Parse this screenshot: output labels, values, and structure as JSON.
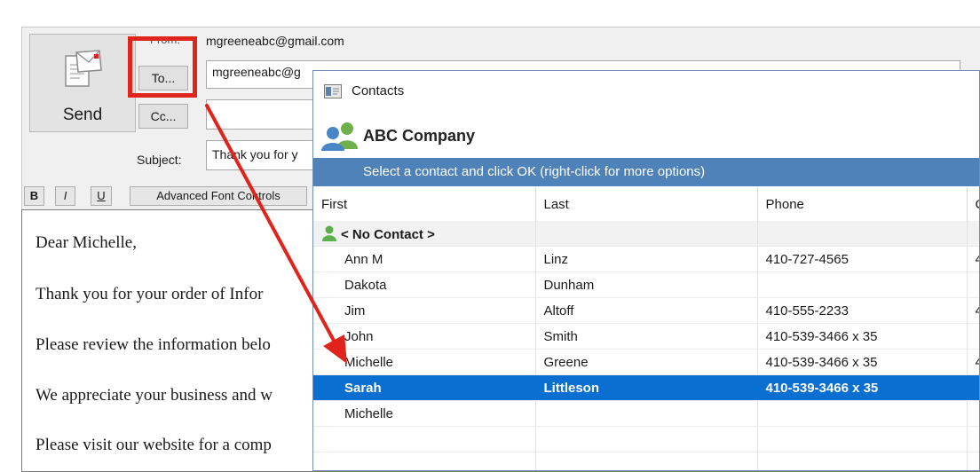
{
  "email": {
    "send_label": "Send",
    "from_label": "From:",
    "from_value": "mgreeneabc@gmail.com",
    "to_button": "To...",
    "to_value": "mgreeneabc@g",
    "cc_button": "Cc...",
    "cc_value": "",
    "subject_label": "Subject:",
    "subject_value": "Thank you for y",
    "format": {
      "bold": "B",
      "italic": "I",
      "underline": "U",
      "advanced": "Advanced Font Controls"
    },
    "body_lines": [
      "Dear Michelle,",
      "Thank you for your order of Infor",
      "Please review the information belo",
      "We appreciate your business and w",
      "Please visit our website for a comp"
    ]
  },
  "dialog": {
    "title": "Contacts",
    "company": "ABC Company",
    "banner": "Select a contact and click OK  (right-click for more options)",
    "columns": [
      "First",
      "Last",
      "Phone",
      "C"
    ],
    "no_contact": "< No Contact >",
    "rows": [
      {
        "first": "Ann M",
        "last": "Linz",
        "phone": "410-727-4565",
        "extra": "4"
      },
      {
        "first": "Dakota",
        "last": "Dunham",
        "phone": "",
        "extra": ""
      },
      {
        "first": "Jim",
        "last": "Altoff",
        "phone": "410-555-2233",
        "extra": "4"
      },
      {
        "first": "John",
        "last": "Smith",
        "phone": "410-539-3466 x 35",
        "extra": ""
      },
      {
        "first": "Michelle",
        "last": "Greene",
        "phone": "410-539-3466 x 35",
        "extra": "4"
      },
      {
        "first": "Sarah",
        "last": "Littleson",
        "phone": "410-539-3466 x 35",
        "extra": ""
      },
      {
        "first": "Michelle",
        "last": "",
        "phone": "",
        "extra": ""
      }
    ],
    "selected_row": 5
  },
  "colors": {
    "highlight": "#e0241b",
    "selection": "#0a6fd0",
    "banner": "#4e82b9"
  }
}
